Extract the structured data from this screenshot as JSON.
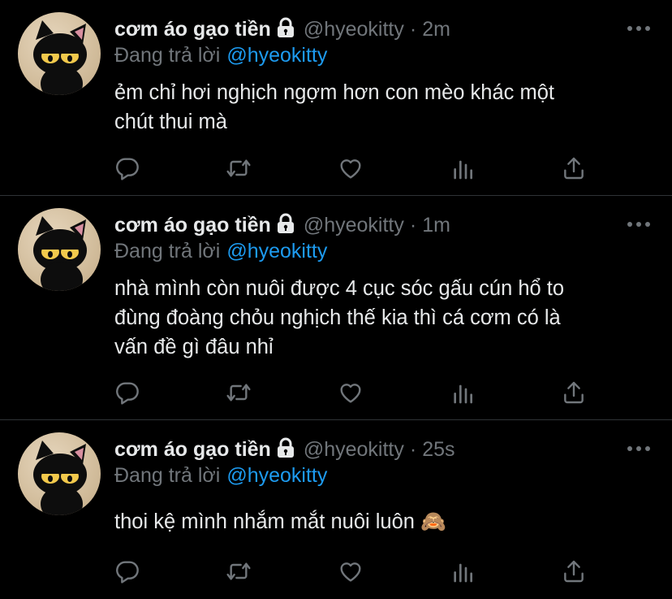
{
  "tweets": [
    {
      "name": "cơm áo gạo tiền",
      "handle": "@hyeokitty",
      "separator": "·",
      "time": "2m",
      "reply_prefix": "Đang trả lời",
      "reply_to": "@hyeokitty",
      "lines": [
        "ẻm chỉ hơi nghịch ngợm hơn con mèo khác một",
        "chút thui mà"
      ]
    },
    {
      "name": "cơm áo gạo tiền",
      "handle": "@hyeokitty",
      "separator": "·",
      "time": "1m",
      "reply_prefix": "Đang trả lời",
      "reply_to": "@hyeokitty",
      "lines": [
        "nhà mình còn nuôi được 4 cục sóc gấu cún hổ to",
        "đùng đoàng chỏu nghịch thế kia thì cá cơm có là",
        "vấn đề gì đâu nhỉ"
      ]
    },
    {
      "name": "cơm áo gạo tiền",
      "handle": "@hyeokitty",
      "separator": "·",
      "time": "25s",
      "reply_prefix": "Đang trả lời",
      "reply_to": "@hyeokitty",
      "lines": [
        "thoi kệ mình nhắm mắt nuôi luôn 🙈"
      ]
    }
  ],
  "icons": {
    "lock": "lock-icon",
    "more": "more-horizontal-icon",
    "reply": "reply-icon",
    "retweet": "retweet-icon",
    "like": "heart-icon",
    "analytics": "analytics-icon",
    "share": "share-icon"
  },
  "colors": {
    "background": "#000000",
    "text": "#e7e9ea",
    "muted": "#71767b",
    "accent": "#1d9bf0",
    "divider": "#2f3336"
  }
}
